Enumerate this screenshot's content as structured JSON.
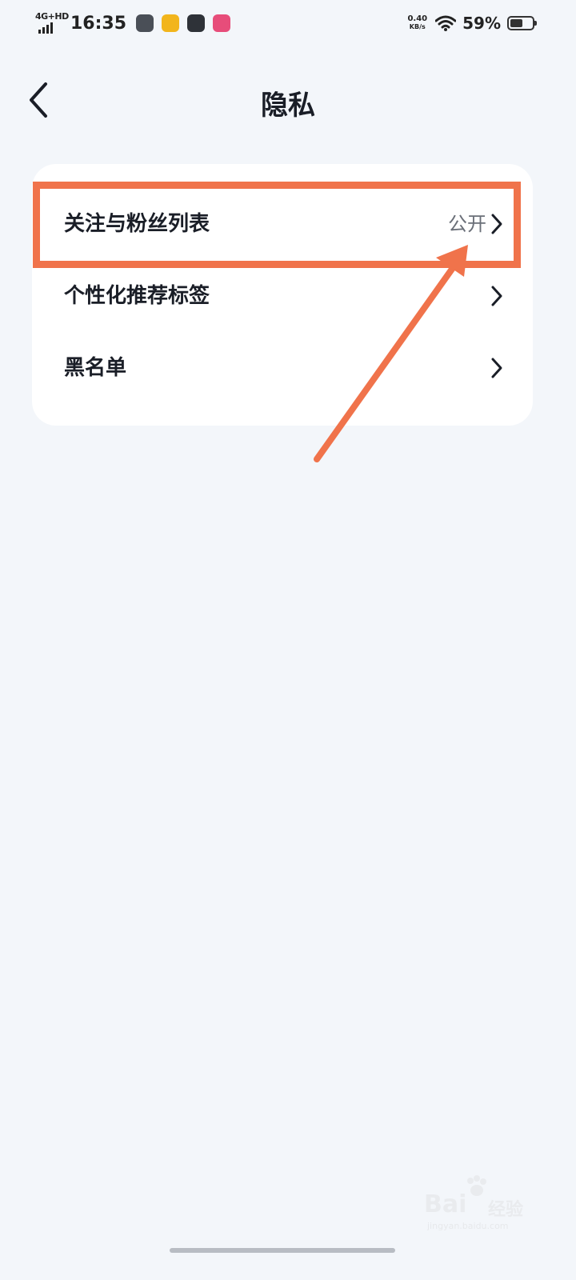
{
  "status_bar": {
    "network": "4G+HD",
    "time": "16:35",
    "speed_value": "0.40",
    "speed_unit": "KB/s",
    "battery_percent": "59%",
    "battery_level": 0.59
  },
  "header": {
    "title": "隐私"
  },
  "settings": {
    "items": [
      {
        "label": "关注与粉丝列表",
        "value": "公开"
      },
      {
        "label": "个性化推荐标签",
        "value": ""
      },
      {
        "label": "黑名单",
        "value": ""
      }
    ]
  },
  "annotation": {
    "color": "#f0734b"
  },
  "watermark": {
    "word": "Bai",
    "word2": "经验",
    "sub": "jingyan.baidu.com"
  },
  "colors": {
    "background": "#f3f6fa",
    "card": "#ffffff",
    "text_primary": "#1a1e27",
    "text_secondary": "#6a6f78"
  }
}
